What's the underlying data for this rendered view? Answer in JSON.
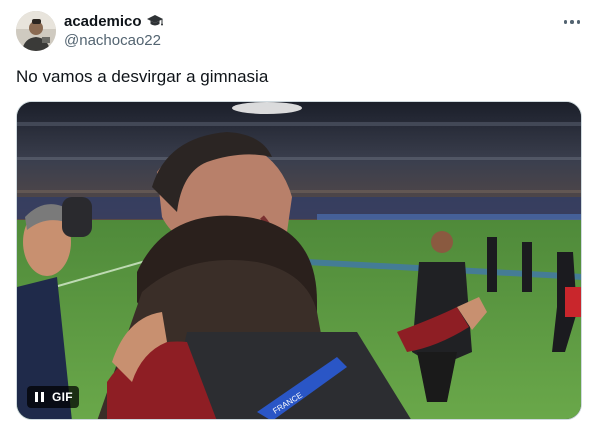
{
  "author": {
    "display_name": "academico",
    "badge_icon": "graduation-cap-icon",
    "handle": "@nachocao22",
    "avatar_icon": "avatar-photo"
  },
  "tweet": {
    "text": "No vamos a desvirgar a gimnasia"
  },
  "media": {
    "type": "gif",
    "badge_label": "GIF",
    "pause_icon": "pause-icon",
    "lanyard_text": "FRANCE"
  },
  "colors": {
    "text_primary": "#0f1419",
    "text_secondary": "#536471",
    "border": "#cfd9de"
  }
}
